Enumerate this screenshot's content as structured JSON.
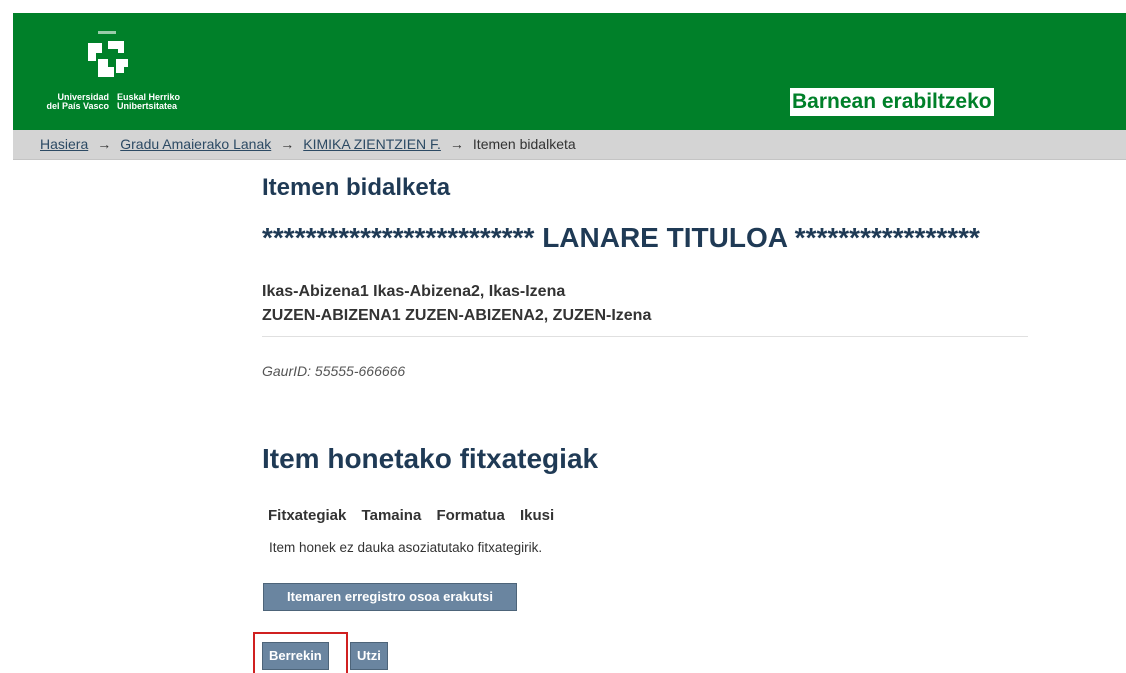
{
  "header": {
    "logo_es_line1": "Universidad",
    "logo_es_line2": "del País Vasco",
    "logo_eu_line1": "Euskal Herriko",
    "logo_eu_line2": "Unibertsitatea",
    "internal_label": "Barnean erabiltzeko",
    "bg_color": "#008029"
  },
  "breadcrumb": {
    "items": [
      "Hasiera",
      "Gradu Amaierako Lanak",
      "KIMIKA ZIENTZIEN F.",
      "Itemen bidalketa"
    ],
    "separator": "→"
  },
  "page": {
    "title": "Itemen bidalketa",
    "item_title": "************************* LANARE TITULOA *****************",
    "author_line1": "Ikas-Abizena1 Ikas-Abizena2, Ikas-Izena",
    "author_line2": "ZUZEN-ABIZENA1 ZUZEN-ABIZENA2, ZUZEN-Izena",
    "gaurid": "GaurID: 55555-666666"
  },
  "files": {
    "heading": "Item honetako fitxategiak",
    "columns": [
      "Fitxategiak",
      "Tamaina",
      "Formatua",
      "Ikusi"
    ],
    "empty_message": "Item honek ez dauka asoziatutako fitxategirik."
  },
  "buttons": {
    "show_full": "Itemaren erregistro osoa erakutsi",
    "back": "Berrekin",
    "cancel": "Utzi"
  }
}
